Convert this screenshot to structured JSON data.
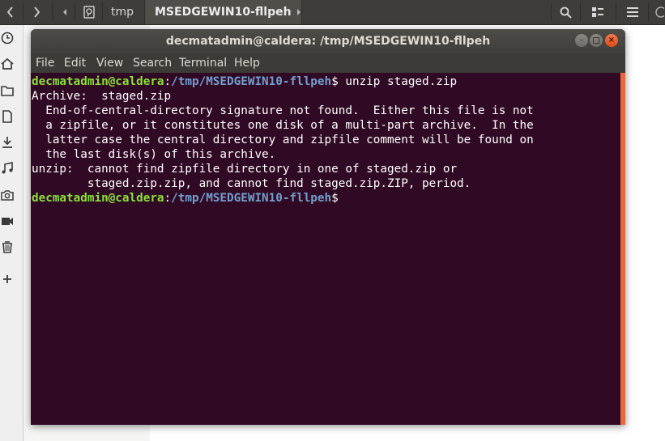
{
  "filemanager": {
    "breadcrumb": [
      "tmp",
      "MSEDGEWIN10-fllpeh"
    ],
    "back_icon": "chevron-left",
    "forward_icon": "chevron-right",
    "search_icon": "search",
    "view_icon": "list",
    "menu_icon": "hamburger"
  },
  "terminal": {
    "title": "decmatadmin@caldera: /tmp/MSEDGEWIN10-fllpeh",
    "menu": [
      "File",
      "Edit",
      "View",
      "Search",
      "Terminal",
      "Help"
    ],
    "prompt": {
      "user_host": "decmatadmin@caldera",
      "sep": ":",
      "path": "/tmp/MSEDGEWIN10-fllpeh",
      "symbol": "$ "
    },
    "command": "unzip staged.zip",
    "output": [
      "Archive:  staged.zip",
      "  End-of-central-directory signature not found.  Either this file is not",
      "  a zipfile, or it constitutes one disk of a multi-part archive.  In the",
      "  latter case the central directory and zipfile comment will be found on",
      "  the last disk(s) of this archive.",
      "unzip:  cannot find zipfile directory in one of staged.zip or",
      "        staged.zip.zip, and cannot find staged.zip.ZIP, period."
    ],
    "colors": {
      "background": "#300a24",
      "user": "#8ae234",
      "path": "#729fcf",
      "scrollbar": "#e9673b"
    }
  },
  "sidebar_icons": [
    "clock-icon",
    "home-icon",
    "folder-icon",
    "document-icon",
    "download-icon",
    "music-icon",
    "camera-icon",
    "video-icon",
    "trash-icon",
    "plus-icon"
  ]
}
